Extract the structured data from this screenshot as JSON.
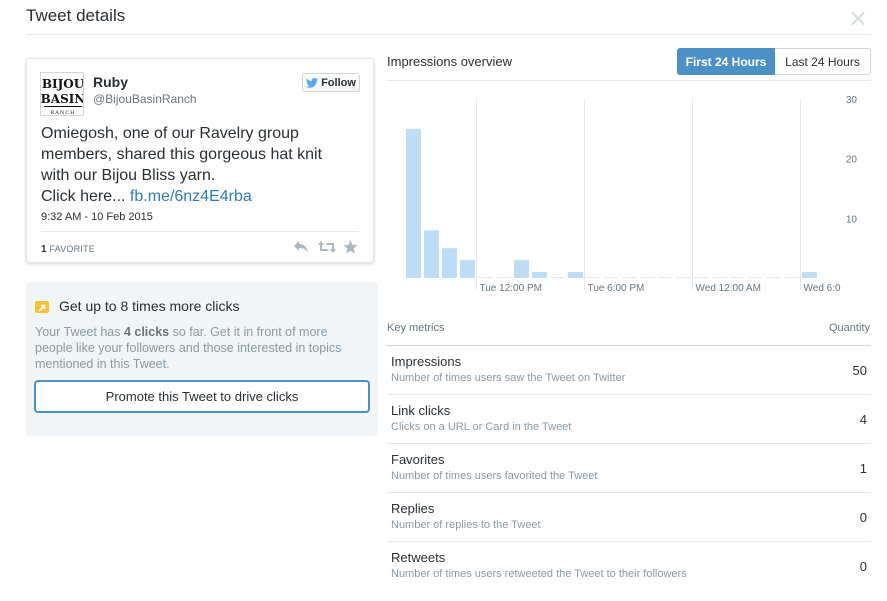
{
  "header": {
    "title": "Tweet details",
    "close_label": "×"
  },
  "tweet": {
    "name": "Ruby",
    "handle": "@BijouBasinRanch",
    "follow_label": "Follow",
    "text_lines": [
      "Omiegosh, one of our Ravelry group",
      "members, shared this gorgeous hat knit",
      "with our Bijou Bliss yarn.",
      "Click here... "
    ],
    "link_text": "fb.me/6nz4E4rba",
    "timestamp": "9:32 AM - 10 Feb 2015",
    "favorite_count": "1",
    "favorite_label": "FAVORITE",
    "avatar_text": {
      "line1": "BIJOU",
      "line2": "BASIN",
      "line3": "RANCH"
    }
  },
  "promo": {
    "title": "Get up to 8 times more clicks",
    "desc_line1_prefix": "Your Tweet has ",
    "desc_line1_bold": "4 clicks",
    "desc_line1_suffix": " so far. Get it in front of more",
    "desc_line2": "people like your followers and those interested in topics",
    "desc_line3": "mentioned in this Tweet.",
    "button_label": "Promote this Tweet to drive clicks"
  },
  "impressions": {
    "title": "Impressions overview",
    "toggle": {
      "active": "First 24 Hours",
      "inactive": "Last 24 Hours"
    }
  },
  "chart_data": {
    "type": "bar",
    "xlabel": "",
    "ylabel": "",
    "ylim": [
      0,
      30
    ],
    "y_ticks": [
      10,
      20,
      30
    ],
    "x_tick_labels": [
      "Tue 12:00 PM",
      "Tue 6:00 PM",
      "Wed 12:00 AM",
      "Wed 6:0"
    ],
    "x_tick_hours": [
      4,
      10,
      16,
      22
    ],
    "values": [
      25,
      8,
      5,
      3,
      0,
      0,
      3,
      1,
      0,
      1,
      0,
      0,
      0,
      0,
      0,
      0,
      0,
      0,
      0,
      0,
      0,
      0,
      1
    ],
    "grid": true,
    "colors": {
      "bar": "#bddcf5",
      "grid": "#e1e8ed",
      "tick": "#66757f"
    }
  },
  "metrics": {
    "header_label": "Key metrics",
    "quantity_label": "Quantity",
    "items": [
      {
        "name": "Impressions",
        "desc": "Number of times users saw the Tweet on Twitter",
        "value": "50"
      },
      {
        "name": "Link clicks",
        "desc": "Clicks on a URL or Card in the Tweet",
        "value": "4"
      },
      {
        "name": "Favorites",
        "desc": "Number of times users favorited the Tweet",
        "value": "1"
      },
      {
        "name": "Replies",
        "desc": "Number of replies to the Tweet",
        "value": "0"
      },
      {
        "name": "Retweets",
        "desc": "Number of times users retweeted the Tweet to their followers",
        "value": "0"
      }
    ]
  },
  "icons": {
    "close": "close-icon",
    "bird": "twitter-bird-icon",
    "reply": "reply-icon",
    "retweet": "retweet-icon",
    "favorite": "star-icon",
    "promo": "promote-icon"
  }
}
